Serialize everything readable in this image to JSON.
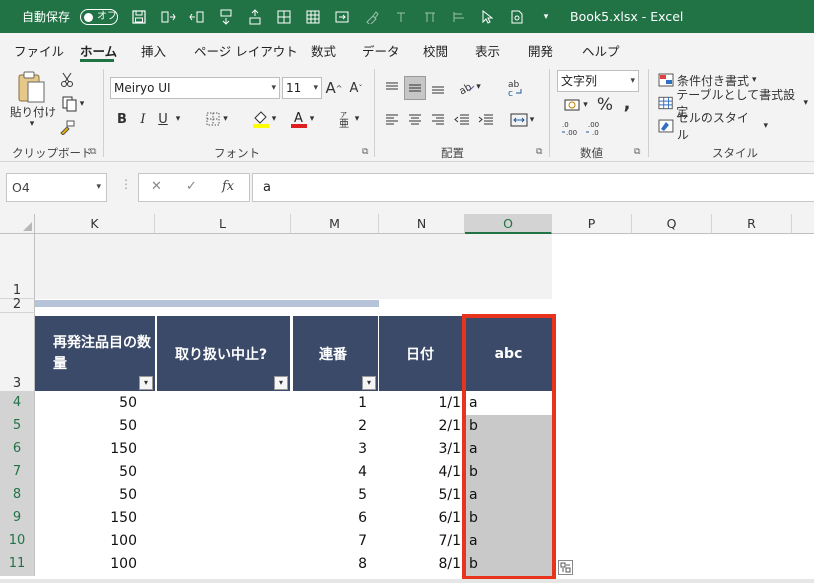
{
  "titlebar": {
    "autosave_label": "自動保存",
    "toggle_text": "オフ",
    "document_title": "Book5.xlsx  -  Excel"
  },
  "tabs": [
    "ファイル",
    "ホーム",
    "挿入",
    "ページ レイアウト",
    "数式",
    "データ",
    "校閲",
    "表示",
    "開発",
    "ヘルプ"
  ],
  "ribbon": {
    "paste_label": "貼り付け",
    "clipboard_group": "クリップボード",
    "font_name": "Meiryo UI",
    "font_size": "11",
    "font_group": "フォント",
    "alignment_group": "配置",
    "number_format": "文字列",
    "number_group": "数値",
    "styles_group": "スタイル",
    "conditional_format": "条件付き書式",
    "format_as_table": "テーブルとして書式設定",
    "cell_styles": "セルのスタイル",
    "bold": "B",
    "italic": "I",
    "underline": "U"
  },
  "formula_bar": {
    "name_box": "O4",
    "formula": "a"
  },
  "columns": [
    {
      "label": "K"
    },
    {
      "label": "L"
    },
    {
      "label": "M"
    },
    {
      "label": "N"
    },
    {
      "label": "O"
    },
    {
      "label": "P"
    },
    {
      "label": "Q"
    },
    {
      "label": "R"
    }
  ],
  "rows": [
    "1",
    "2",
    "3",
    "4",
    "5",
    "6",
    "7",
    "8",
    "9",
    "10",
    "11"
  ],
  "table": {
    "headers": [
      "再発注品目の数量",
      "取り扱い中止?",
      "連番",
      "日付",
      "abc"
    ],
    "data": [
      {
        "qty": "50",
        "seq": "1",
        "date": "1/1",
        "abc": "a"
      },
      {
        "qty": "50",
        "seq": "2",
        "date": "2/1",
        "abc": "b"
      },
      {
        "qty": "150",
        "seq": "3",
        "date": "3/1",
        "abc": "a"
      },
      {
        "qty": "50",
        "seq": "4",
        "date": "4/1",
        "abc": "b"
      },
      {
        "qty": "50",
        "seq": "5",
        "date": "5/1",
        "abc": "a"
      },
      {
        "qty": "150",
        "seq": "6",
        "date": "6/1",
        "abc": "b"
      },
      {
        "qty": "100",
        "seq": "7",
        "date": "7/1",
        "abc": "a"
      },
      {
        "qty": "100",
        "seq": "8",
        "date": "8/1",
        "abc": "b"
      }
    ]
  },
  "colors": {
    "excel_green": "#217346",
    "header_fill": "#3b4a69",
    "highlight_border": "#e8341c"
  }
}
